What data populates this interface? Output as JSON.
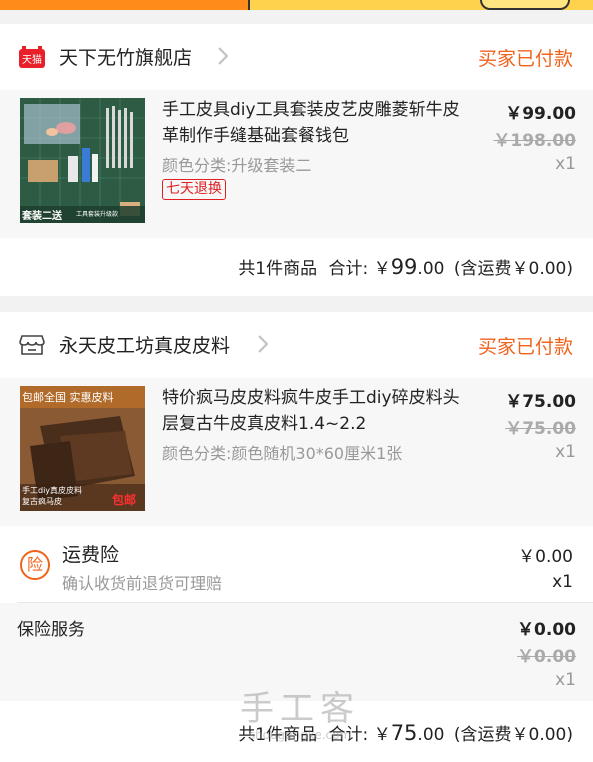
{
  "orders": [
    {
      "shop_name": "天下无竹旗舰店",
      "shop_icon": "tmall-icon",
      "shop_badge": "天猫",
      "status": "买家已付款",
      "item": {
        "title": "手工皮具diy工具套装皮艺皮雕菱斩牛皮革制作手缝基础套餐钱包",
        "sku": "颜色分类:升级套装二",
        "tag": "七天退换",
        "price": "￥99.00",
        "original_price": "￥198.00",
        "qty": "x1",
        "thumb_caption_main": "套装二送",
        "thumb_caption_sub": "工具套装升级款"
      },
      "summary": {
        "count_text": "共1件商品",
        "total_label": "合计:",
        "currency": "￥",
        "total_int": "99",
        "total_dec": ".00",
        "shipping": "(含运费￥0.00)"
      }
    },
    {
      "shop_name": "永天皮工坊真皮皮料",
      "shop_icon": "store-icon",
      "status": "买家已付款",
      "item": {
        "title": "特价疯马皮皮料疯牛皮手工diy碎皮料头层复古牛皮真皮料1.4~2.2",
        "sku": "颜色分类:颜色随机30*60厘米1张",
        "price": "￥75.00",
        "original_price": "￥75.00",
        "qty": "x1",
        "thumb_caption_top": "包邮全国 实惠皮料",
        "thumb_caption_bottom1": "手工diy真皮皮料",
        "thumb_caption_bottom2": "复古疯马皮",
        "thumb_caption_free": "包邮"
      },
      "insurance": {
        "icon_char": "险",
        "title": "运费险",
        "desc": "确认收货前退货可理赔",
        "price": "￥0.00",
        "qty": "x1"
      },
      "service": {
        "label": "保险服务",
        "price": "￥0.00",
        "original_price": "￥0.00",
        "qty": "x1"
      },
      "summary": {
        "count_text": "共1件商品",
        "total_label": "合计:",
        "currency": "￥",
        "total_int": "75",
        "total_dec": ".00",
        "shipping": "(含运费￥0.00)"
      }
    }
  ],
  "watermark": {
    "main": "手工客",
    "sub": "shougongke.com"
  },
  "colors": {
    "accent": "#f0631c",
    "return_tag": "#e02020",
    "muted": "#999999"
  }
}
